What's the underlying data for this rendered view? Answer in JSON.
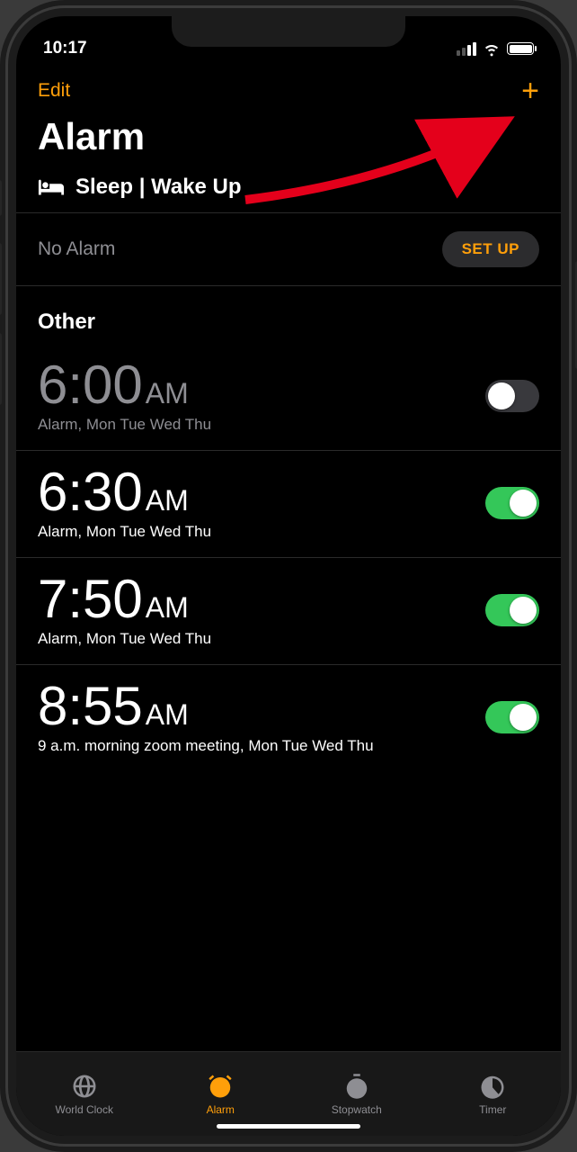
{
  "status": {
    "time": "10:17"
  },
  "nav": {
    "edit": "Edit",
    "add_icon": "+"
  },
  "title": "Alarm",
  "sleep": {
    "header": "Sleep | Wake Up",
    "no_alarm": "No Alarm",
    "setup": "SET UP"
  },
  "section_other": "Other",
  "alarms": [
    {
      "time": "6:00",
      "ampm": "AM",
      "label": "Alarm, Mon Tue Wed Thu",
      "on": false
    },
    {
      "time": "6:30",
      "ampm": "AM",
      "label": "Alarm, Mon Tue Wed Thu",
      "on": true
    },
    {
      "time": "7:50",
      "ampm": "AM",
      "label": "Alarm, Mon Tue Wed Thu",
      "on": true
    },
    {
      "time": "8:55",
      "ampm": "AM",
      "label": "9 a.m. morning zoom meeting, Mon Tue Wed Thu",
      "on": true
    }
  ],
  "tabs": {
    "world_clock": "World Clock",
    "alarm": "Alarm",
    "stopwatch": "Stopwatch",
    "timer": "Timer"
  }
}
